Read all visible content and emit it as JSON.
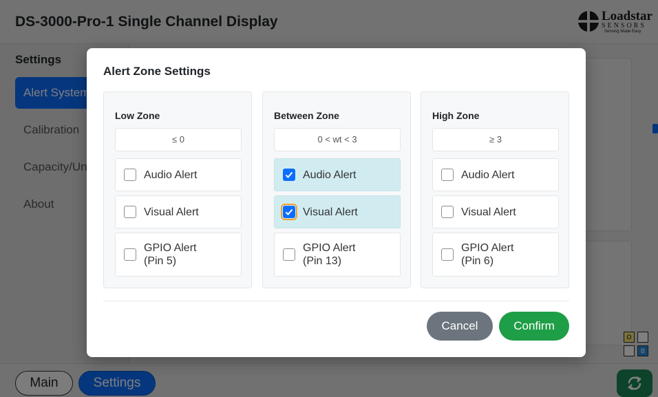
{
  "app": {
    "title": "DS-3000-Pro-1 Single Channel Display",
    "logo": {
      "word": "Loadstar",
      "sub": "SENSORS",
      "tagline": "Sensing Made Easy"
    }
  },
  "sidebar": {
    "heading": "Settings",
    "items": [
      {
        "label": "Alert System",
        "active": true
      },
      {
        "label": "Calibration",
        "active": false
      },
      {
        "label": "Capacity/Units",
        "active": false
      },
      {
        "label": "About",
        "active": false
      }
    ]
  },
  "footer": {
    "main_label": "Main",
    "settings_label": "Settings",
    "ob_widget": {
      "o": "O",
      "b": "B"
    }
  },
  "modal": {
    "title": "Alert Zone Settings",
    "zones": [
      {
        "name": "Low Zone",
        "range": "≤ 0",
        "options": [
          {
            "line1": "Audio Alert",
            "line2": "",
            "checked": false
          },
          {
            "line1": "Visual Alert",
            "line2": "",
            "checked": false
          },
          {
            "line1": "GPIO Alert",
            "line2": "(Pin 5)",
            "checked": false
          }
        ]
      },
      {
        "name": "Between Zone",
        "range": "0 < wt < 3",
        "options": [
          {
            "line1": "Audio Alert",
            "line2": "",
            "checked": true
          },
          {
            "line1": "Visual Alert",
            "line2": "",
            "checked": true
          },
          {
            "line1": "GPIO Alert",
            "line2": "(Pin 13)",
            "checked": false
          }
        ]
      },
      {
        "name": "High Zone",
        "range": "≥ 3",
        "options": [
          {
            "line1": "Audio Alert",
            "line2": "",
            "checked": false
          },
          {
            "line1": "Visual Alert",
            "line2": "",
            "checked": false
          },
          {
            "line1": "GPIO Alert",
            "line2": "(Pin 6)",
            "checked": false
          }
        ]
      }
    ],
    "cancel_label": "Cancel",
    "confirm_label": "Confirm"
  },
  "colors": {
    "primary": "#0d6efd",
    "confirm": "#1e9e46",
    "cancel": "#6c757d",
    "checked_bg": "#d1ecf1"
  }
}
